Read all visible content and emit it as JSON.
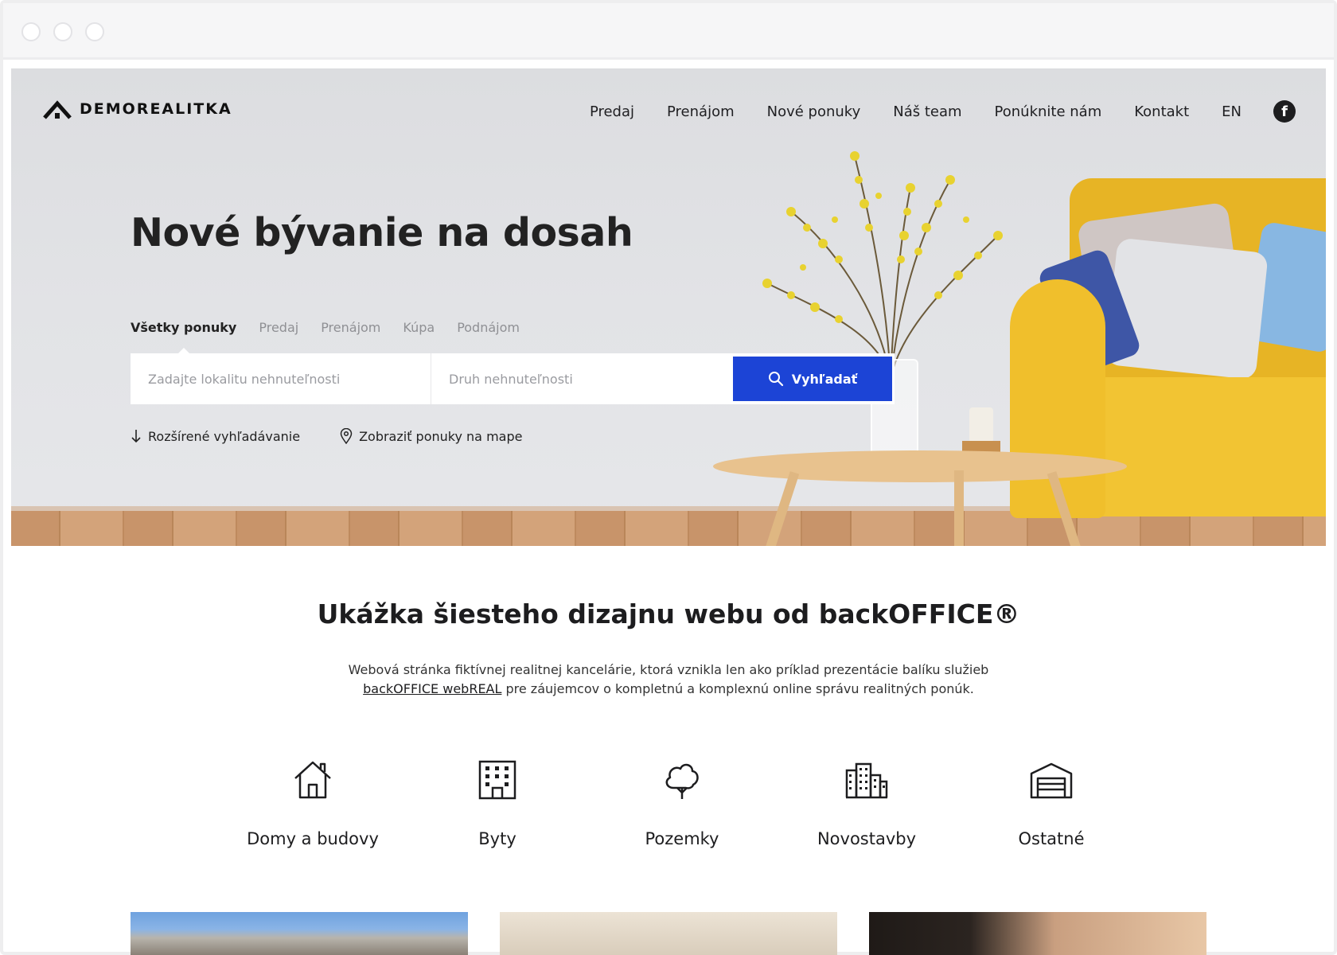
{
  "brand": {
    "name": "DEMOREALITKA"
  },
  "nav": {
    "items": [
      "Predaj",
      "Prenájom",
      "Nové ponuky",
      "Náš team",
      "Ponúknite nám",
      "Kontakt",
      "EN"
    ],
    "social": "facebook-icon"
  },
  "hero": {
    "title": "Nové bývanie na dosah",
    "tabs": [
      "Všetky ponuky",
      "Predaj",
      "Prenájom",
      "Kúpa",
      "Podnájom"
    ],
    "active_tab": "Všetky ponuky",
    "search": {
      "location_placeholder": "Zadajte lokalitu nehnuteľnosti",
      "type_placeholder": "Druh nehnuteľnosti",
      "button_label": "Vyhľadať"
    },
    "links": {
      "advanced": "Rozšírené vyhľadávanie",
      "map": "Zobraziť ponuky na mape"
    }
  },
  "intro": {
    "title": "Ukážka šiesteho dizajnu webu od backOFFICE®",
    "desc_part1": "Webová stránka fiktívnej realitnej kancelárie, ktorá vznikla len ako príklad prezentácie balíku služieb",
    "desc_link": "backOFFICE webREAL",
    "desc_part2": " pre záujemcov o kompletnú a komplexnú online správu realitných ponúk."
  },
  "categories": [
    {
      "label": "Domy a budovy",
      "icon": "house-icon"
    },
    {
      "label": "Byty",
      "icon": "apartment-building-icon"
    },
    {
      "label": "Pozemky",
      "icon": "tree-icon"
    },
    {
      "label": "Novostavby",
      "icon": "new-buildings-icon"
    },
    {
      "label": "Ostatné",
      "icon": "garage-icon"
    }
  ],
  "colors": {
    "accent": "#1c44d6",
    "text": "#1d1d1f",
    "muted": "#8f9094"
  }
}
